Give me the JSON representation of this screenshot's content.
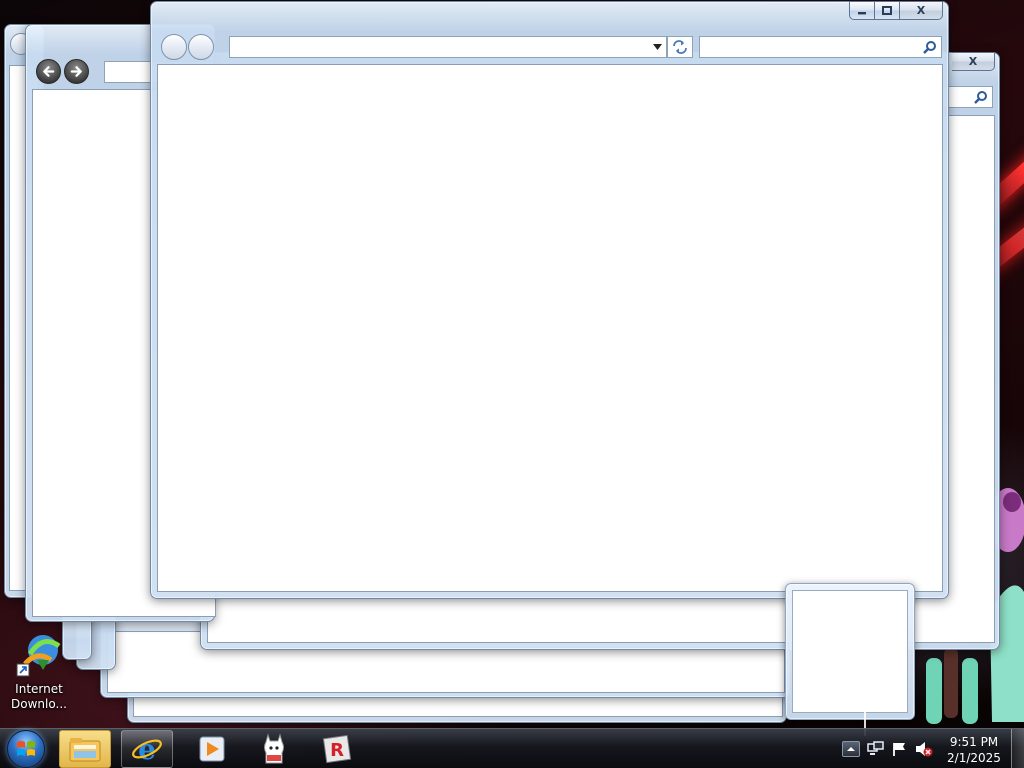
{
  "desktop": {
    "icons": [
      {
        "label": "Internet Downlo...",
        "icon": "internet-download-manager-icon"
      }
    ]
  },
  "windows": [
    {
      "id": "front-window",
      "address_value": "",
      "search_value": "",
      "buttons": {
        "minimize": "–",
        "maximize": "▫",
        "close": "X"
      }
    },
    {
      "id": "right-window",
      "buttons": {
        "close": "X"
      }
    },
    {
      "id": "left-window",
      "address_value": ""
    }
  ],
  "taskbar": {
    "pinned": [
      {
        "name": "windows-explorer",
        "icon": "folder-icon"
      },
      {
        "name": "internet-explorer",
        "icon": "ie-icon",
        "active": true
      },
      {
        "name": "media-player",
        "icon": "media-player-icon"
      },
      {
        "name": "llama-app",
        "icon": "llama-icon"
      },
      {
        "name": "roblox",
        "icon": "roblox-icon"
      }
    ],
    "tray": {
      "icons": [
        "show-hidden-icons-arrow",
        "network-icon",
        "action-center-flag-icon",
        "volume-muted-icon"
      ],
      "time": "9:51 PM",
      "date": "2/1/2025"
    }
  },
  "colors": {
    "aero_frame": "#c6daf0",
    "taskbar": "#16181e",
    "desktop_bg": "#26080c",
    "accent_red": "#ff3030"
  }
}
